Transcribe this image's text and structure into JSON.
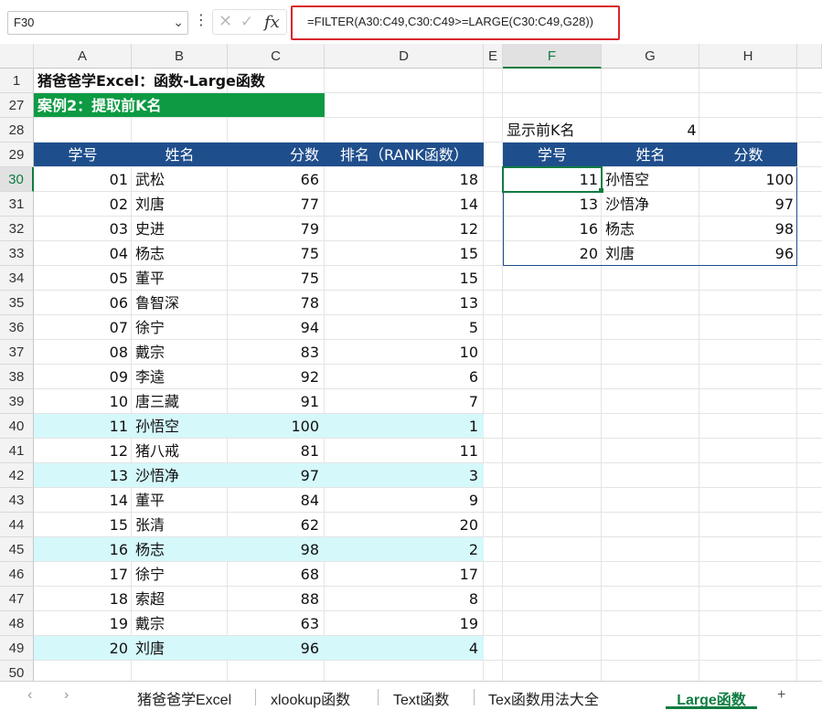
{
  "namebox": "F30",
  "formula": "=FILTER(A30:C49,C30:C49>=LARGE(C30:C49,G28))",
  "columns": [
    "A",
    "B",
    "C",
    "D",
    "E",
    "F",
    "G",
    "H"
  ],
  "selected_column": "F",
  "selected_row": "30",
  "row1_title": "猪爸爸学Excel：函数-Large函数",
  "row27_title": "案例2：提取前K名",
  "k_label": "显示前K名",
  "k_value": "4",
  "left_headers": [
    "学号",
    "姓名",
    "分数",
    "排名（RANK函数）"
  ],
  "right_headers": [
    "学号",
    "姓名",
    "分数"
  ],
  "rows": [
    {
      "row": "30",
      "id": "01",
      "name": "武松",
      "score": "66",
      "rank": "18",
      "hl": false
    },
    {
      "row": "31",
      "id": "02",
      "name": "刘唐",
      "score": "77",
      "rank": "14",
      "hl": false
    },
    {
      "row": "32",
      "id": "03",
      "name": "史进",
      "score": "79",
      "rank": "12",
      "hl": false
    },
    {
      "row": "33",
      "id": "04",
      "name": "杨志",
      "score": "75",
      "rank": "15",
      "hl": false
    },
    {
      "row": "34",
      "id": "05",
      "name": "董平",
      "score": "75",
      "rank": "15",
      "hl": false
    },
    {
      "row": "35",
      "id": "06",
      "name": "鲁智深",
      "score": "78",
      "rank": "13",
      "hl": false
    },
    {
      "row": "36",
      "id": "07",
      "name": "徐宁",
      "score": "94",
      "rank": "5",
      "hl": false
    },
    {
      "row": "37",
      "id": "08",
      "name": "戴宗",
      "score": "83",
      "rank": "10",
      "hl": false
    },
    {
      "row": "38",
      "id": "09",
      "name": "李逵",
      "score": "92",
      "rank": "6",
      "hl": false
    },
    {
      "row": "39",
      "id": "10",
      "name": "唐三藏",
      "score": "91",
      "rank": "7",
      "hl": false
    },
    {
      "row": "40",
      "id": "11",
      "name": "孙悟空",
      "score": "100",
      "rank": "1",
      "hl": true
    },
    {
      "row": "41",
      "id": "12",
      "name": "猪八戒",
      "score": "81",
      "rank": "11",
      "hl": false
    },
    {
      "row": "42",
      "id": "13",
      "name": "沙悟净",
      "score": "97",
      "rank": "3",
      "hl": true
    },
    {
      "row": "43",
      "id": "14",
      "name": "董平",
      "score": "84",
      "rank": "9",
      "hl": false
    },
    {
      "row": "44",
      "id": "15",
      "name": "张清",
      "score": "62",
      "rank": "20",
      "hl": false
    },
    {
      "row": "45",
      "id": "16",
      "name": "杨志",
      "score": "98",
      "rank": "2",
      "hl": true
    },
    {
      "row": "46",
      "id": "17",
      "name": "徐宁",
      "score": "68",
      "rank": "17",
      "hl": false
    },
    {
      "row": "47",
      "id": "18",
      "name": "索超",
      "score": "88",
      "rank": "8",
      "hl": false
    },
    {
      "row": "48",
      "id": "19",
      "name": "戴宗",
      "score": "63",
      "rank": "19",
      "hl": false
    },
    {
      "row": "49",
      "id": "20",
      "name": "刘唐",
      "score": "96",
      "rank": "4",
      "hl": true
    }
  ],
  "results": [
    {
      "id": "11",
      "name": "孙悟空",
      "score": "100"
    },
    {
      "id": "13",
      "name": "沙悟净",
      "score": "97"
    },
    {
      "id": "16",
      "name": "杨志",
      "score": "98"
    },
    {
      "id": "20",
      "name": "刘唐",
      "score": "96"
    }
  ],
  "extra_rows": [
    "1",
    "27",
    "28",
    "29",
    "50"
  ],
  "sheet_tabs": [
    "猪爸爸学Excel",
    "xlookup函数",
    "Text函数",
    "Tex函数用法大全"
  ],
  "active_tab": "Large函数",
  "add_sheet": "+",
  "colors": {
    "header_blue": "#1f4e8c",
    "title_green": "#0e9a43",
    "highlight": "#d5f8fb",
    "formula_border": "#d9252b",
    "excel_green": "#107c41"
  }
}
